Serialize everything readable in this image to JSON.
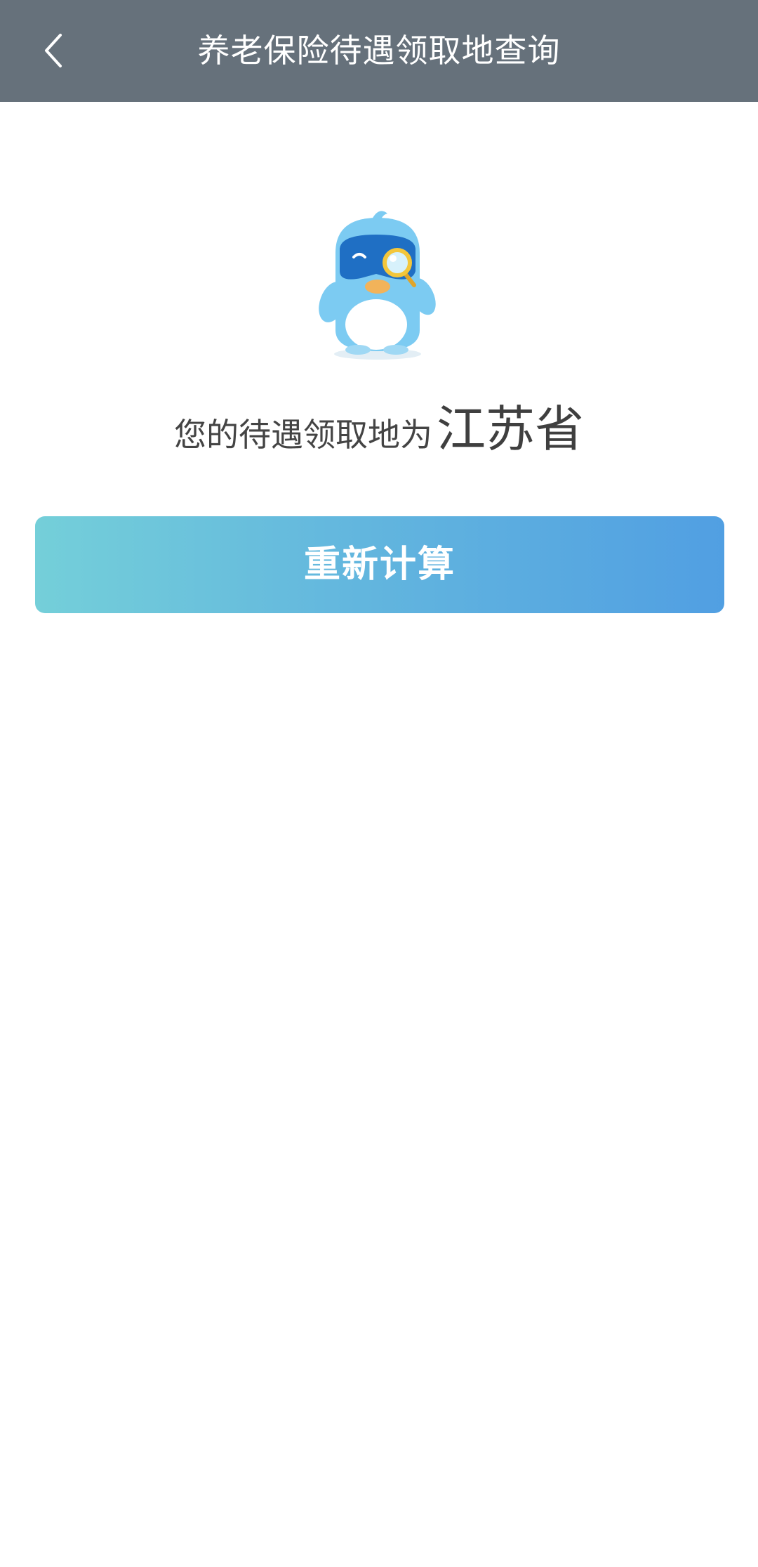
{
  "header": {
    "title": "养老保险待遇领取地查询",
    "back_icon": "chevron-left-icon"
  },
  "mascot": {
    "icon": "mascot-magnifier-icon",
    "colors": {
      "body": "#7ccbf2",
      "mask": "#1f6fc4",
      "belly": "#ffffff",
      "beak": "#f2b35a",
      "lens_rim": "#f3c63b"
    }
  },
  "result": {
    "prefix": "您的待遇领取地为",
    "value": "江苏省"
  },
  "actions": {
    "recalculate_label": "重新计算"
  },
  "theme": {
    "header_bg": "#66717b",
    "button_gradient_start": "#74cfd9",
    "button_gradient_end": "#519fe2"
  }
}
